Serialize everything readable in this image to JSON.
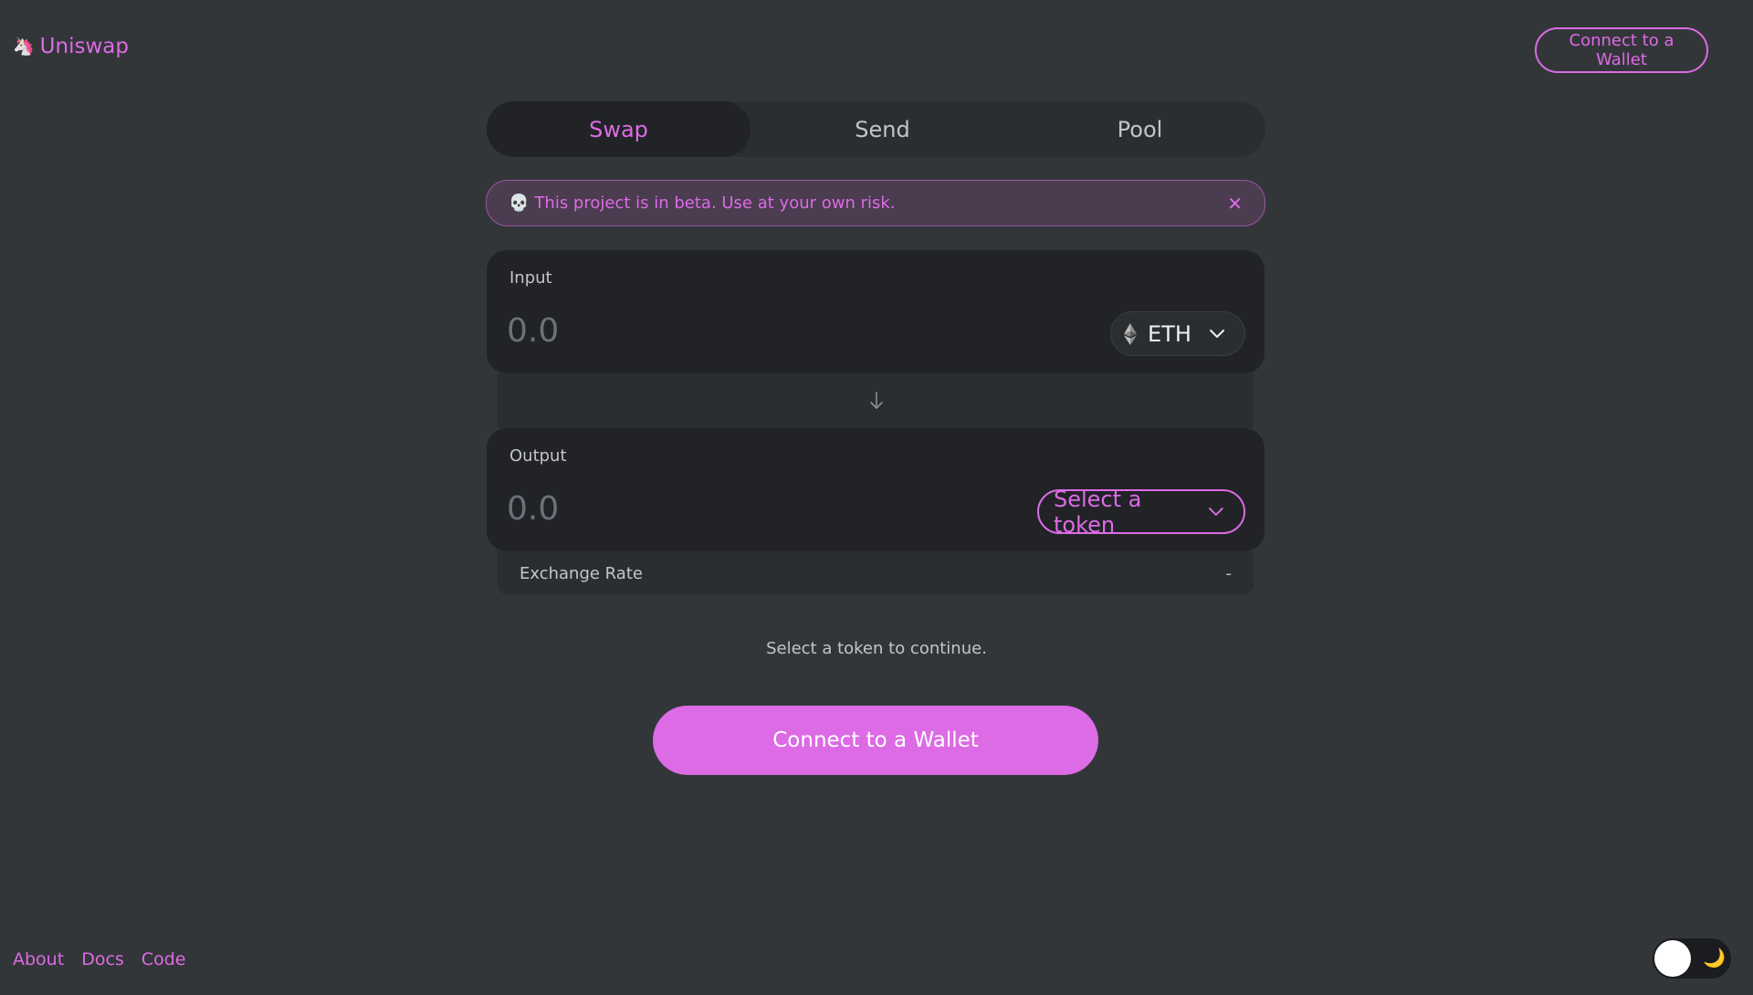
{
  "header": {
    "brand": "Uniswap",
    "connect_label": "Connect to a Wallet"
  },
  "tabs": [
    {
      "label": "Swap",
      "active": true
    },
    {
      "label": "Send",
      "active": false
    },
    {
      "label": "Pool",
      "active": false
    }
  ],
  "warning": {
    "text": "This project is in beta. Use at your own risk."
  },
  "input": {
    "label": "Input",
    "amount_placeholder": "0.0",
    "token": "ETH"
  },
  "output": {
    "label": "Output",
    "amount_placeholder": "0.0",
    "token": "Select a token"
  },
  "exchange_rate": {
    "label": "Exchange Rate",
    "value": "-"
  },
  "hint": "Select a token to continue.",
  "main_button": "Connect to a Wallet",
  "footer": {
    "links": [
      "About",
      "Docs",
      "Code"
    ]
  },
  "colors": {
    "accent": "#dc6be5",
    "background": "#333639",
    "card": "#212327"
  },
  "icons": {
    "brand": "unicorn-icon",
    "warning": "skull-icon",
    "close": "close-icon",
    "token": "eth-icon",
    "dropdown": "chevron-down-icon",
    "swap_direction": "arrow-down-icon",
    "theme": "moon-icon"
  }
}
